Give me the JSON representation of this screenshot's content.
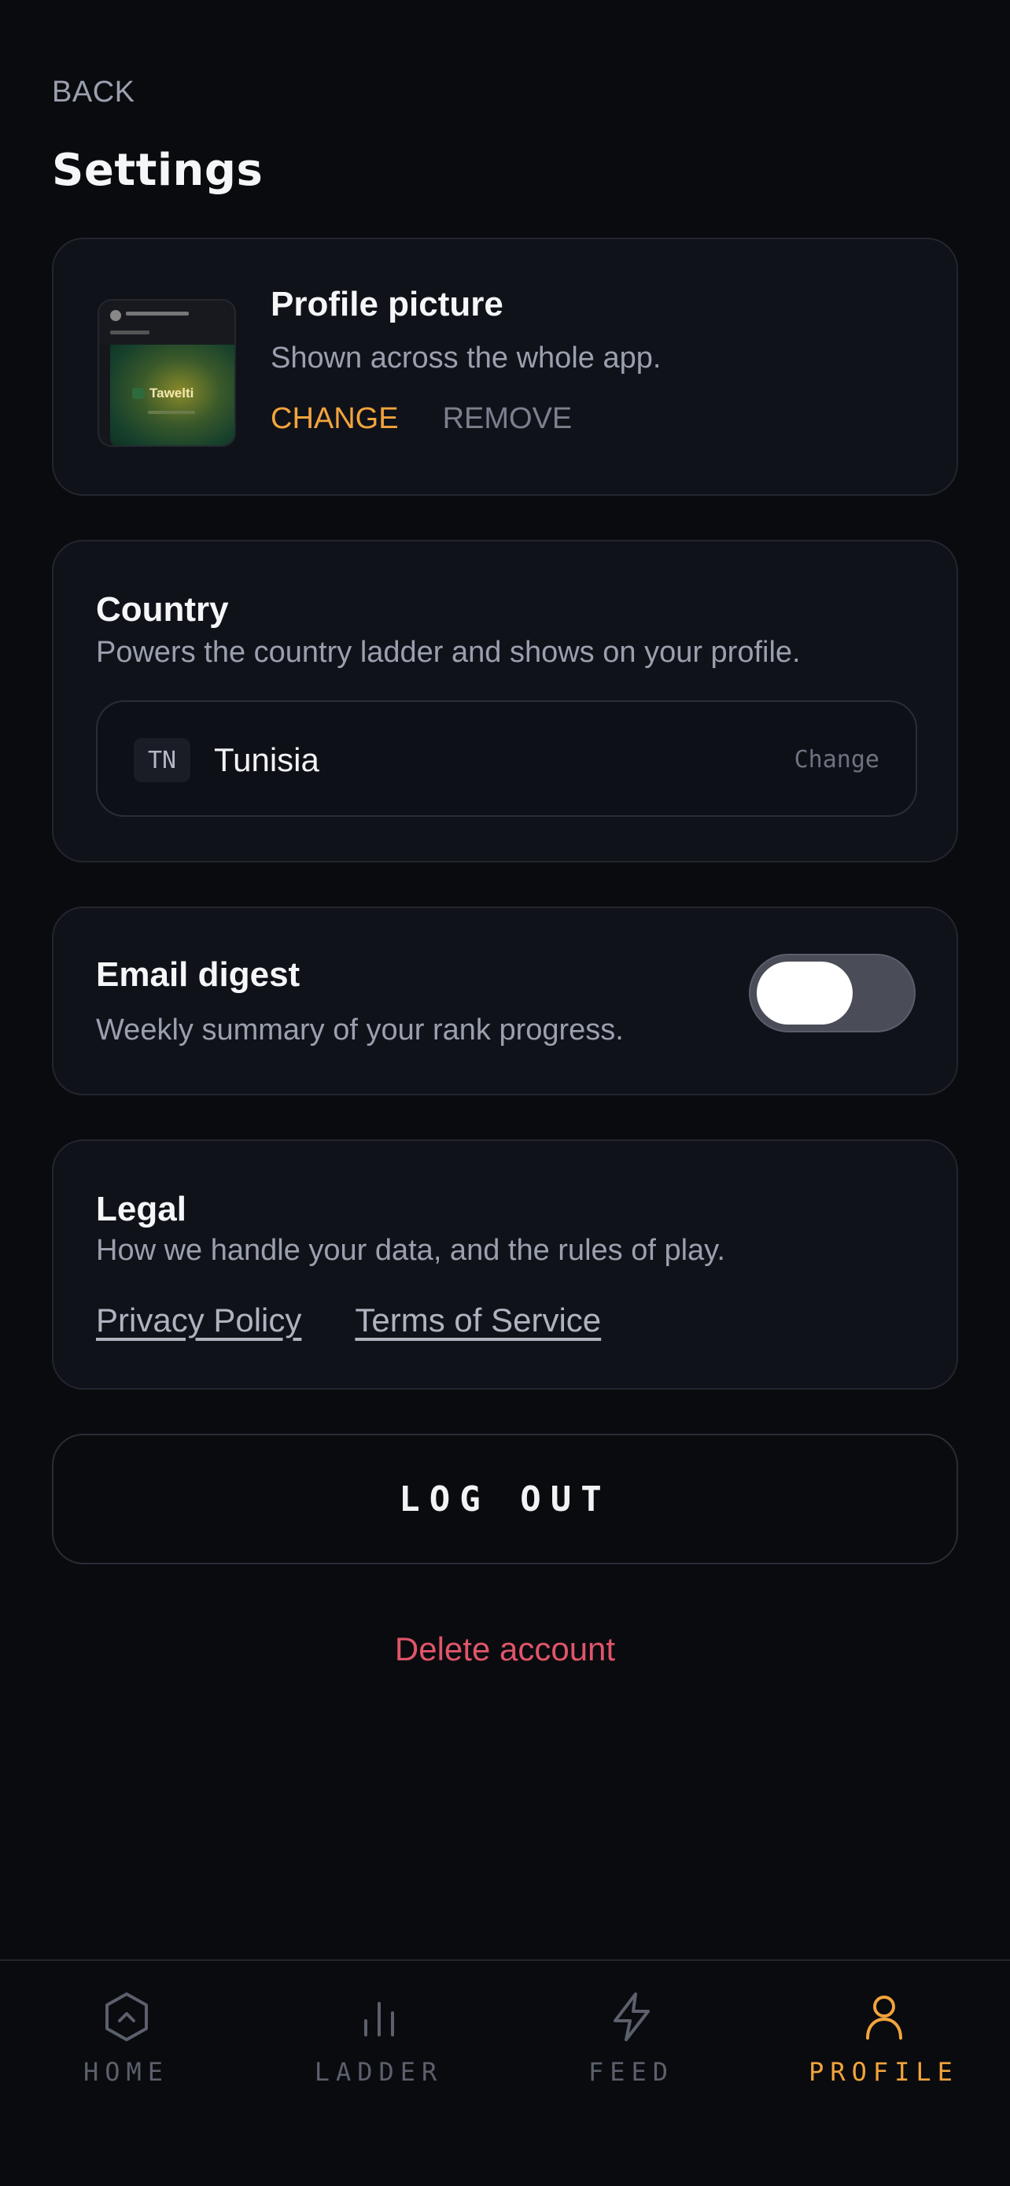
{
  "header": {
    "back_label": "BACK",
    "title": "Settings"
  },
  "profile_picture": {
    "heading": "Profile picture",
    "subtitle": "Shown across the whole app.",
    "change_label": "CHANGE",
    "remove_label": "REMOVE",
    "thumbnail_brand": "Tawelti"
  },
  "country": {
    "heading": "Country",
    "subtitle": "Powers the country ladder and shows on your profile.",
    "code": "TN",
    "name": "Tunisia",
    "change_label": "Change"
  },
  "email_digest": {
    "heading": "Email digest",
    "subtitle": "Weekly summary of your rank progress.",
    "enabled": false
  },
  "legal": {
    "heading": "Legal",
    "subtitle": "How we handle your data, and the rules of play.",
    "privacy_label": "Privacy Policy",
    "terms_label": "Terms of Service"
  },
  "actions": {
    "logout_label": "LOG OUT",
    "delete_label": "Delete account"
  },
  "nav": {
    "items": [
      {
        "label": "HOME",
        "icon": "home-hexagon-icon",
        "active": false
      },
      {
        "label": "LADDER",
        "icon": "ladder-bars-icon",
        "active": false
      },
      {
        "label": "FEED",
        "icon": "lightning-icon",
        "active": false
      },
      {
        "label": "PROFILE",
        "icon": "user-icon",
        "active": true
      }
    ]
  },
  "colors": {
    "background": "#0a0b0f",
    "card": "#10121a",
    "accent": "#f2a43c",
    "danger": "#e0556a",
    "muted": "#9aa0ad"
  }
}
